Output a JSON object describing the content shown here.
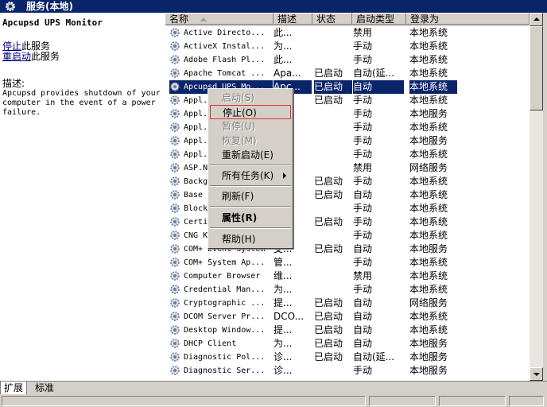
{
  "window": {
    "title": "服务(本地)",
    "icon": "gear-icon"
  },
  "left_panel": {
    "service_name": "Apcupsd UPS Monitor",
    "action_stop_link": "停止",
    "action_stop_suffix": "此服务",
    "action_restart_link": "重启动",
    "action_restart_suffix": "此服务",
    "description_label": "描述:",
    "description": "Apcupsd provides shutdown of your computer in the event of a power failure."
  },
  "columns": {
    "name": "名称",
    "desc": "描述",
    "status": "状态",
    "startup": "启动类型",
    "logon": "登录为"
  },
  "rows": [
    {
      "name": "Active Directo...",
      "desc": "此...",
      "status": "",
      "startup": "禁用",
      "logon": "本地系统"
    },
    {
      "name": "ActiveX Instal...",
      "desc": "为...",
      "status": "",
      "startup": "手动",
      "logon": "本地系统"
    },
    {
      "name": "Adobe Flash Pl...",
      "desc": "此...",
      "status": "",
      "startup": "手动",
      "logon": "本地系统"
    },
    {
      "name": "Apache Tomcat ...",
      "desc": "Apa...",
      "status": "已启动",
      "startup": "自动(延...",
      "logon": "本地系统"
    },
    {
      "name": "Apcupsd UPS Mo...",
      "desc": "Apc...",
      "status": "已启动",
      "startup": "自动",
      "logon": "本地系统",
      "selected": true
    },
    {
      "name": "Appl...",
      "desc": "",
      "status": "已启动",
      "startup": "手动",
      "logon": "本地系统"
    },
    {
      "name": "Appl...",
      "desc": "",
      "status": "",
      "startup": "手动",
      "logon": "本地服务"
    },
    {
      "name": "Appl...",
      "desc": "",
      "status": "",
      "startup": "手动",
      "logon": "本地系统"
    },
    {
      "name": "Appl...",
      "desc": "",
      "status": "",
      "startup": "手动",
      "logon": "本地服务"
    },
    {
      "name": "Appl...",
      "desc": "",
      "status": "",
      "startup": "手动",
      "logon": "本地系统"
    },
    {
      "name": "ASP.N...",
      "desc": "",
      "status": "",
      "startup": "禁用",
      "logon": "网络服务"
    },
    {
      "name": "Backg...",
      "desc": "",
      "status": "已启动",
      "startup": "手动",
      "logon": "本地系统"
    },
    {
      "name": "Base ...",
      "desc": "",
      "status": "已启动",
      "startup": "自动",
      "logon": "本地系统"
    },
    {
      "name": "Block...",
      "desc": "",
      "status": "",
      "startup": "手动",
      "logon": "本地系统"
    },
    {
      "name": "Certi...",
      "desc": "",
      "status": "已启动",
      "startup": "手动",
      "logon": "本地系统"
    },
    {
      "name": "CNG K...",
      "desc": "",
      "status": "",
      "startup": "手动",
      "logon": "本地系统"
    },
    {
      "name": "COM+ Event System",
      "desc": "支...",
      "status": "已启动",
      "startup": "自动",
      "logon": "本地服务"
    },
    {
      "name": "COM+ System Ap...",
      "desc": "管...",
      "status": "",
      "startup": "手动",
      "logon": "本地系统"
    },
    {
      "name": "Computer Browser",
      "desc": "维...",
      "status": "",
      "startup": "禁用",
      "logon": "本地系统"
    },
    {
      "name": "Credential Man...",
      "desc": "为...",
      "status": "",
      "startup": "手动",
      "logon": "本地系统"
    },
    {
      "name": "Cryptographic ...",
      "desc": "提...",
      "status": "已启动",
      "startup": "自动",
      "logon": "网络服务"
    },
    {
      "name": "DCOM Server Pr...",
      "desc": "DCO...",
      "status": "已启动",
      "startup": "自动",
      "logon": "本地系统"
    },
    {
      "name": "Desktop Window...",
      "desc": "提...",
      "status": "已启动",
      "startup": "自动",
      "logon": "本地系统"
    },
    {
      "name": "DHCP Client",
      "desc": "为...",
      "status": "已启动",
      "startup": "自动",
      "logon": "本地服务"
    },
    {
      "name": "Diagnostic Pol...",
      "desc": "诊...",
      "status": "已启动",
      "startup": "自动(延...",
      "logon": "本地服务"
    },
    {
      "name": "Diagnostic Ser...",
      "desc": "诊...",
      "status": "",
      "startup": "手动",
      "logon": "本地服务"
    }
  ],
  "context_menu": {
    "start": "启动(S)",
    "stop": "停止(O)",
    "pause": "暂停(U)",
    "resume": "恢复(M)",
    "restart": "重新启动(E)",
    "all_tasks": "所有任务(K)",
    "refresh": "刷新(F)",
    "properties": "属性(R)",
    "help": "帮助(H)"
  },
  "tabs": {
    "extended": "扩展",
    "standard": "标准"
  }
}
